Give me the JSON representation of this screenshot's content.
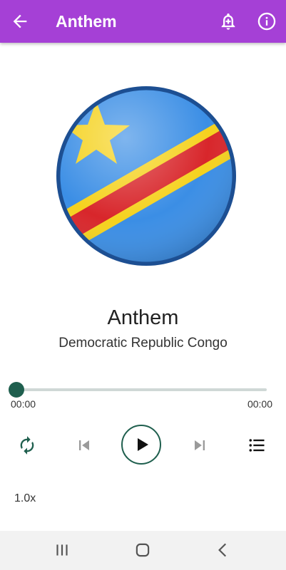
{
  "appbar": {
    "title": "Anthem",
    "background": "#a540d6",
    "icons": [
      "arrow-back-icon",
      "alarm-add-icon",
      "info-icon"
    ]
  },
  "artwork": {
    "icon": "drc-flag-badge-icon",
    "colors": {
      "blue": "#3b8ee5",
      "yellow": "#f5d21e",
      "red": "#d8262b"
    }
  },
  "track": {
    "title": "Anthem",
    "subtitle": "Democratic Republic Congo"
  },
  "player": {
    "progress": 0,
    "elapsed": "00:00",
    "duration": "00:00",
    "accent": "#1f5f4e",
    "speed": "1.0x",
    "controls": [
      "repeat-icon",
      "skip-previous-icon",
      "play-icon",
      "skip-next-icon",
      "playlist-icon"
    ]
  },
  "system_nav": {
    "icons": [
      "recent-apps-icon",
      "home-icon",
      "back-icon"
    ]
  }
}
